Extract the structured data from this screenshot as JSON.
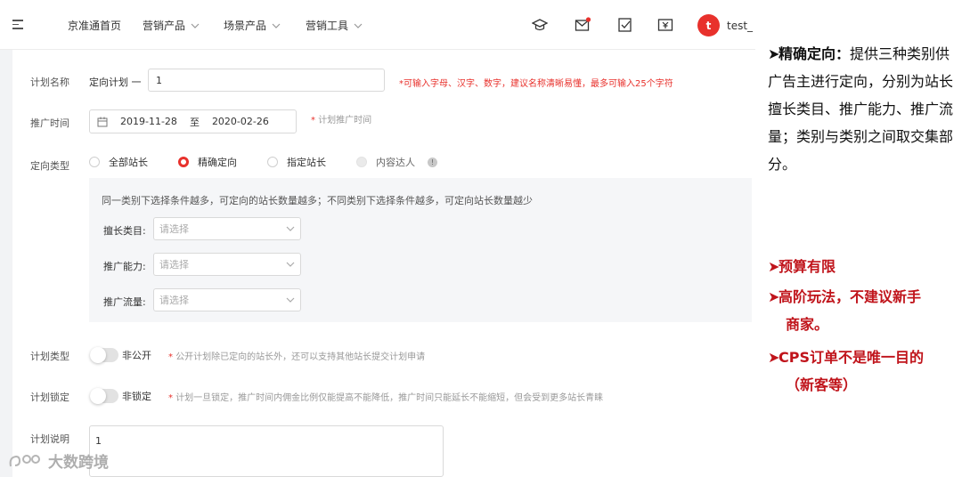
{
  "nav": {
    "items": [
      "京准通首页",
      "营销产品",
      "场景产品",
      "营销工具"
    ],
    "username": "test_"
  },
  "form": {
    "plan_name": {
      "label": "计划名称",
      "prefix": "定向计划 一",
      "value": "1",
      "hint": "*可输入字母、汉字、数字，建议名称清晰易懂，最多可输入25个字符"
    },
    "promo_time": {
      "label": "推广时间",
      "start": "2019-11-28",
      "sep": "至",
      "end": "2020-02-26",
      "hint": "计划推广时间"
    },
    "target_type": {
      "label": "定向类型",
      "options": [
        "全部站长",
        "精确定向",
        "指定站长",
        "内容达人"
      ],
      "selected": "精确定向"
    },
    "conditions": {
      "tip": "同一类别下选择条件越多，可定向的站长数量越多；不同类别下选择条件越多，可定向站长数量越少",
      "fields": [
        {
          "label": "擅长类目:",
          "placeholder": "请选择"
        },
        {
          "label": "推广能力:",
          "placeholder": "请选择"
        },
        {
          "label": "推广流量:",
          "placeholder": "请选择"
        }
      ]
    },
    "plan_type": {
      "label": "计划类型",
      "switch_text": "非公开",
      "hint": "公开计划除已定向的站长外，还可以支持其他站长提交计划申请"
    },
    "plan_lock": {
      "label": "计划锁定",
      "switch_text": "非锁定",
      "hint": "计划一旦锁定，推广时间内佣金比例仅能提高不能降低，推广时间只能延长不能缩短，但会受到更多站长青睐"
    },
    "plan_desc": {
      "label": "计划说明",
      "value": "1"
    }
  },
  "watermark": "大数跨境",
  "notes": {
    "precise": {
      "title": "精确定向：",
      "body": "提供三种类别供广告主进行定向，分别为站长擅长类目、推广能力、推广流量；类别与类别之间取交集部分。"
    },
    "budget": "预算有限",
    "advanced_1": "高阶玩法，不建议新手",
    "advanced_2": "商家。",
    "cps_1": "CPS订单不是唯一目的",
    "cps_2": "（新客等）"
  },
  "colors": {
    "accent": "#e8312c",
    "note_red": "#c0141b"
  }
}
